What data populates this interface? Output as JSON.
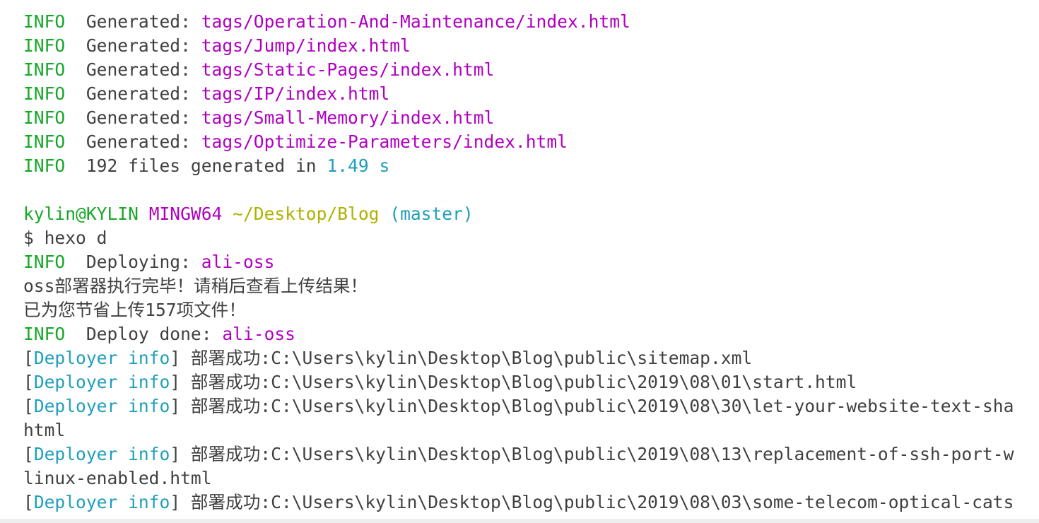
{
  "colors": {
    "info": "#16a827",
    "path": "#b000c0",
    "number": "#1e9fb8",
    "dir": "#b0b000",
    "text": "#404040"
  },
  "lines": [
    {
      "segments": [
        {
          "text": "INFO",
          "color": "green"
        },
        {
          "text": "  Generated: ",
          "color": "dark"
        },
        {
          "text": "tags/Operation-And-Maintenance/index.html",
          "color": "magenta"
        }
      ]
    },
    {
      "segments": [
        {
          "text": "INFO",
          "color": "green"
        },
        {
          "text": "  Generated: ",
          "color": "dark"
        },
        {
          "text": "tags/Jump/index.html",
          "color": "magenta"
        }
      ]
    },
    {
      "segments": [
        {
          "text": "INFO",
          "color": "green"
        },
        {
          "text": "  Generated: ",
          "color": "dark"
        },
        {
          "text": "tags/Static-Pages/index.html",
          "color": "magenta"
        }
      ]
    },
    {
      "segments": [
        {
          "text": "INFO",
          "color": "green"
        },
        {
          "text": "  Generated: ",
          "color": "dark"
        },
        {
          "text": "tags/IP/index.html",
          "color": "magenta"
        }
      ]
    },
    {
      "segments": [
        {
          "text": "INFO",
          "color": "green"
        },
        {
          "text": "  Generated: ",
          "color": "dark"
        },
        {
          "text": "tags/Small-Memory/index.html",
          "color": "magenta"
        }
      ]
    },
    {
      "segments": [
        {
          "text": "INFO",
          "color": "green"
        },
        {
          "text": "  Generated: ",
          "color": "dark"
        },
        {
          "text": "tags/Optimize-Parameters/index.html",
          "color": "magenta"
        }
      ]
    },
    {
      "segments": [
        {
          "text": "INFO",
          "color": "green"
        },
        {
          "text": "  192 files generated in ",
          "color": "dark"
        },
        {
          "text": "1.49 s",
          "color": "cyan"
        }
      ]
    },
    {
      "segments": []
    },
    {
      "segments": [
        {
          "text": "kylin@KYLIN",
          "color": "green"
        },
        {
          "text": " ",
          "color": "dark"
        },
        {
          "text": "MINGW64",
          "color": "magenta"
        },
        {
          "text": " ",
          "color": "dark"
        },
        {
          "text": "~/Desktop/Blog",
          "color": "olive"
        },
        {
          "text": " ",
          "color": "dark"
        },
        {
          "text": "(master)",
          "color": "cyan"
        }
      ]
    },
    {
      "segments": [
        {
          "text": "$ hexo d",
          "color": "dark"
        }
      ]
    },
    {
      "segments": [
        {
          "text": "INFO",
          "color": "green"
        },
        {
          "text": "  Deploying: ",
          "color": "dark"
        },
        {
          "text": "ali-oss",
          "color": "magenta"
        }
      ]
    },
    {
      "segments": [
        {
          "text": "oss部署器执行完毕！请稍后查看上传结果！",
          "color": "dark"
        }
      ]
    },
    {
      "segments": [
        {
          "text": "已为您节省上传157项文件！",
          "color": "dark"
        }
      ]
    },
    {
      "segments": [
        {
          "text": "INFO",
          "color": "green"
        },
        {
          "text": "  Deploy done: ",
          "color": "dark"
        },
        {
          "text": "ali-oss",
          "color": "magenta"
        }
      ]
    },
    {
      "segments": [
        {
          "text": "[",
          "color": "dark"
        },
        {
          "text": "Deployer info",
          "color": "cyan"
        },
        {
          "text": "] 部署成功:C:\\Users\\kylin\\Desktop\\Blog\\public\\sitemap.xml",
          "color": "dark"
        }
      ]
    },
    {
      "segments": [
        {
          "text": "[",
          "color": "dark"
        },
        {
          "text": "Deployer info",
          "color": "cyan"
        },
        {
          "text": "] 部署成功:C:\\Users\\kylin\\Desktop\\Blog\\public\\2019\\08\\01\\start.html",
          "color": "dark"
        }
      ]
    },
    {
      "segments": [
        {
          "text": "[",
          "color": "dark"
        },
        {
          "text": "Deployer info",
          "color": "cyan"
        },
        {
          "text": "] 部署成功:C:\\Users\\kylin\\Desktop\\Blog\\public\\2019\\08\\30\\let-your-website-text-sha",
          "color": "dark"
        }
      ]
    },
    {
      "segments": [
        {
          "text": "html",
          "color": "dark"
        }
      ]
    },
    {
      "segments": [
        {
          "text": "[",
          "color": "dark"
        },
        {
          "text": "Deployer info",
          "color": "cyan"
        },
        {
          "text": "] 部署成功:C:\\Users\\kylin\\Desktop\\Blog\\public\\2019\\08\\13\\replacement-of-ssh-port-w",
          "color": "dark"
        }
      ]
    },
    {
      "segments": [
        {
          "text": "linux-enabled.html",
          "color": "dark"
        }
      ]
    },
    {
      "segments": [
        {
          "text": "[",
          "color": "dark"
        },
        {
          "text": "Deployer info",
          "color": "cyan"
        },
        {
          "text": "] 部署成功:C:\\Users\\kylin\\Desktop\\Blog\\public\\2019\\08\\03\\some-telecom-optical-cats",
          "color": "dark"
        }
      ]
    }
  ]
}
